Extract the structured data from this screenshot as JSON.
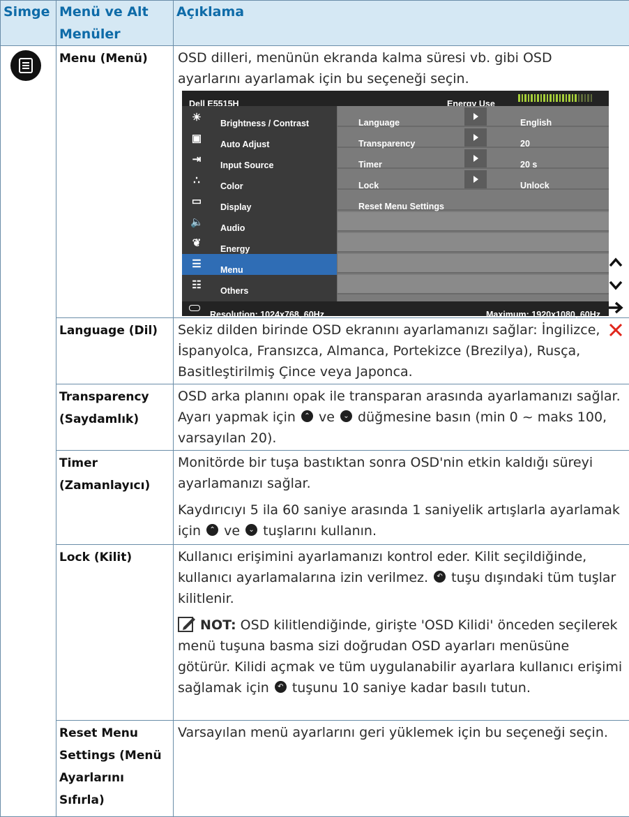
{
  "headers": {
    "icon": "Simge",
    "submenu": "Menü ve Alt Menüler",
    "description": "Açıklama"
  },
  "menu_row": {
    "icon": "menu-icon",
    "title": "Menu (Menü)",
    "description": "OSD dilleri, menünün ekranda kalma süresi vb. gibi OSD ayarlarını ayarlamak için bu seçeneği seçin."
  },
  "osd": {
    "title": "Dell E5515H",
    "energy_label": "Energy Use",
    "energy_level": 0.8,
    "menu_items": [
      {
        "label": "Brightness / Contrast",
        "icon": "sun-icon"
      },
      {
        "label": "Auto Adjust",
        "icon": "auto-adjust-icon"
      },
      {
        "label": "Input Source",
        "icon": "input-source-icon"
      },
      {
        "label": "Color",
        "icon": "color-dots-icon"
      },
      {
        "label": "Display",
        "icon": "display-icon"
      },
      {
        "label": "Audio",
        "icon": "speaker-icon"
      },
      {
        "label": "Energy",
        "icon": "energy-leaf-icon"
      },
      {
        "label": "Menu",
        "icon": "menu-icon",
        "selected": true
      },
      {
        "label": "Others",
        "icon": "sliders-icon"
      }
    ],
    "settings": [
      {
        "label": "Language",
        "value": "English"
      },
      {
        "label": "Transparency",
        "value": "20"
      },
      {
        "label": "Timer",
        "value": "20 s"
      },
      {
        "label": "Lock",
        "value": "Unlock"
      },
      {
        "label": "Reset Menu Settings",
        "value": ""
      }
    ],
    "resolution": "Resolution: 1024x768, 60Hz",
    "maximum": "Maximum: 1920x1080, 60Hz",
    "side_buttons": [
      "up-arrow-icon",
      "down-arrow-icon",
      "right-arrow-icon",
      "close-x-icon"
    ],
    "accent_colors": {
      "selected": "#2f6db5",
      "energy_bar": "#a6ce39",
      "close": "#e0261b"
    }
  },
  "rows": {
    "language": {
      "title": "Language (Dil)",
      "description": "Sekiz dilden birinde OSD ekranını ayarlamanızı sağlar: İngilizce, İspanyolca, Fransızca, Almanca, Portekizce (Brezilya), Rusça, Basitleştirilmiş Çince veya Japonca."
    },
    "transparency": {
      "title": "Transparency (Saydamlık)",
      "desc_a": "OSD arka planını opak ile transparan arasında ayarlamanızı sağlar. Ayarı yapmak için",
      "desc_b": "ve",
      "desc_c": "düğmesine basın (min 0 ~ maks 100, varsayılan 20)."
    },
    "timer": {
      "title": "Timer (Zamanlayıcı)",
      "desc1": "Monitörde bir tuşa bastıktan sonra OSD'nin etkin kaldığı süreyi ayarlamanızı sağlar.",
      "desc2_a": "Kaydırıcıyı 5 ila 60 saniye arasında 1 saniyelik artışlarla ayarlamak için",
      "desc2_b": "ve",
      "desc2_c": "tuşlarını kullanın."
    },
    "lock": {
      "title": "Lock (Kilit)",
      "desc1_a": "Kullanıcı erişimini ayarlamanızı kontrol eder. Kilit seçildiğinde, kullanıcı ayarlamalarına izin verilmez.",
      "desc1_b": "tuşu dışındaki tüm tuşlar kilitlenir.",
      "note_label": "NOT:",
      "note_a": "OSD kilitlendiğinde, girişte 'OSD Kilidi' önceden seçilerek menü tuşuna basma sizi doğrudan OSD ayarları menüsüne götürür. Kilidi açmak ve tüm uygulanabilir ayarlara kullanıcı erişimi sağlamak için",
      "note_b": "tuşunu 10 saniye kadar basılı tutun."
    },
    "reset": {
      "title": "Reset Menu Settings (Menü Ayarlarını Sıfırla)",
      "description": "Varsayılan menü ayarlarını geri yüklemek için bu seçeneği seçin."
    }
  }
}
